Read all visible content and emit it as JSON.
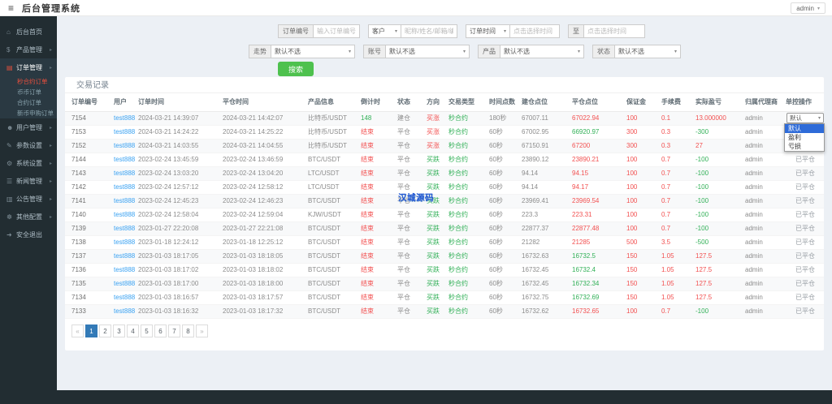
{
  "topbar": {
    "title": "后台管理系统",
    "user": "admin"
  },
  "sidebar": {
    "items": [
      {
        "key": "dashboard",
        "label": "后台首页",
        "icon": "home-icon",
        "glyph": "⌂",
        "arrow": false
      },
      {
        "key": "product",
        "label": "产品管理",
        "icon": "dollar-icon",
        "glyph": "$",
        "arrow": true
      },
      {
        "key": "order",
        "label": "订单管理",
        "icon": "order-icon",
        "glyph": "▤",
        "arrow": true,
        "active": true,
        "children": [
          {
            "key": "second-contract-orders",
            "label": "秒合约订单",
            "active": true
          },
          {
            "key": "coin-orders",
            "label": "币币订单"
          },
          {
            "key": "contract-orders",
            "label": "合约订单"
          },
          {
            "key": "new-coin-orders",
            "label": "新币申购订单"
          }
        ]
      },
      {
        "key": "user",
        "label": "用户管理",
        "icon": "user-icon",
        "glyph": "☻",
        "arrow": true
      },
      {
        "key": "params",
        "label": "参数设置",
        "icon": "document-icon",
        "glyph": "✎",
        "arrow": true
      },
      {
        "key": "system",
        "label": "系统设置",
        "icon": "gears-icon",
        "glyph": "⚙",
        "arrow": true
      },
      {
        "key": "news",
        "label": "新闻管理",
        "icon": "list-icon",
        "glyph": "☰",
        "arrow": true
      },
      {
        "key": "notice",
        "label": "公告管理",
        "icon": "bulletin-icon",
        "glyph": "▥",
        "arrow": true
      },
      {
        "key": "other",
        "label": "其他配置",
        "icon": "gear-icon",
        "glyph": "☸",
        "arrow": true
      },
      {
        "key": "logout",
        "label": "安全退出",
        "icon": "logout-icon",
        "glyph": "➜",
        "arrow": false
      }
    ]
  },
  "filters": {
    "row1": [
      {
        "label": "订单编号",
        "placeholder": "输入订单编号/订单id"
      },
      {
        "label": "客户",
        "placeholder": "昵称/姓名/邮箱/编号"
      },
      {
        "label": "订单时间",
        "placeholder": "点击选择时间"
      },
      {
        "label": "至",
        "placeholder": "点击选择时间"
      }
    ],
    "row2": [
      {
        "label": "走势",
        "value": "默认不选"
      },
      {
        "label": "账号",
        "value": "默认不选"
      },
      {
        "label": "产品",
        "value": "默认不选"
      },
      {
        "label": "状态",
        "value": "默认不选"
      }
    ],
    "search_label": "搜索"
  },
  "table": {
    "title": "交易记录",
    "headers": [
      "订单编号",
      "用户",
      "订单时间",
      "平仓时间",
      "产品信息",
      "倒计时",
      "状态",
      "方向",
      "交易类型",
      "时间点数",
      "建仓点位",
      "平仓点位",
      "保证金",
      "手续费",
      "实际盈亏",
      "归属代理商",
      "单控操作"
    ],
    "rows": [
      {
        "id": "7154",
        "user": "test888",
        "open_time": "2024-03-21 14:39:07",
        "close_time": "2024-03-21 14:42:07",
        "product": "比特币/USDT",
        "countdown": "148",
        "countdown_color": "green",
        "status": "建仓",
        "direction": "买涨",
        "direction_color": "red",
        "trade_type": "秒合约",
        "duration": "180秒",
        "open_price": "67007.11",
        "close_price": "67022.94",
        "close_price_color": "red",
        "margin": "100",
        "fee": "0.1",
        "profit": "13.000000",
        "profit_color": "red",
        "agent": "admin",
        "action": "select"
      },
      {
        "id": "7153",
        "user": "test888",
        "open_time": "2024-03-21 14:24:22",
        "close_time": "2024-03-21 14:25:22",
        "product": "比特币/USDT",
        "countdown": "结束",
        "countdown_color": "red",
        "status": "平仓",
        "direction": "买涨",
        "direction_color": "red",
        "trade_type": "秒合约",
        "duration": "60秒",
        "open_price": "67002.95",
        "close_price": "66920.97",
        "close_price_color": "green",
        "margin": "300",
        "fee": "0.3",
        "profit": "-300",
        "profit_color": "green",
        "agent": "admin",
        "action": ""
      },
      {
        "id": "7152",
        "user": "test888",
        "open_time": "2024-03-21 14:03:55",
        "close_time": "2024-03-21 14:04:55",
        "product": "比特币/USDT",
        "countdown": "结束",
        "countdown_color": "red",
        "status": "平仓",
        "direction": "买涨",
        "direction_color": "red",
        "trade_type": "秒合约",
        "duration": "60秒",
        "open_price": "67150.91",
        "close_price": "67200",
        "close_price_color": "red",
        "margin": "300",
        "fee": "0.3",
        "profit": "27",
        "profit_color": "red",
        "agent": "admin",
        "action": "已平仓"
      },
      {
        "id": "7144",
        "user": "test888",
        "open_time": "2023-02-24 13:45:59",
        "close_time": "2023-02-24 13:46:59",
        "product": "BTC/USDT",
        "countdown": "结束",
        "countdown_color": "red",
        "status": "平仓",
        "direction": "买跌",
        "direction_color": "green",
        "trade_type": "秒合约",
        "duration": "60秒",
        "open_price": "23890.12",
        "close_price": "23890.21",
        "close_price_color": "red",
        "margin": "100",
        "fee": "0.7",
        "profit": "-100",
        "profit_color": "green",
        "agent": "admin",
        "action": "已平仓"
      },
      {
        "id": "7143",
        "user": "test888",
        "open_time": "2023-02-24 13:03:20",
        "close_time": "2023-02-24 13:04:20",
        "product": "LTC/USDT",
        "countdown": "结束",
        "countdown_color": "red",
        "status": "平仓",
        "direction": "买跌",
        "direction_color": "green",
        "trade_type": "秒合约",
        "duration": "60秒",
        "open_price": "94.14",
        "close_price": "94.15",
        "close_price_color": "red",
        "margin": "100",
        "fee": "0.7",
        "profit": "-100",
        "profit_color": "green",
        "agent": "admin",
        "action": "已平仓"
      },
      {
        "id": "7142",
        "user": "test888",
        "open_time": "2023-02-24 12:57:12",
        "close_time": "2023-02-24 12:58:12",
        "product": "LTC/USDT",
        "countdown": "结束",
        "countdown_color": "red",
        "status": "平仓",
        "direction": "买跌",
        "direction_color": "green",
        "trade_type": "秒合约",
        "duration": "60秒",
        "open_price": "94.14",
        "close_price": "94.17",
        "close_price_color": "red",
        "margin": "100",
        "fee": "0.7",
        "profit": "-100",
        "profit_color": "green",
        "agent": "admin",
        "action": "已平仓"
      },
      {
        "id": "7141",
        "user": "test888",
        "open_time": "2023-02-24 12:45:23",
        "close_time": "2023-02-24 12:46:23",
        "product": "BTC/USDT",
        "countdown": "结束",
        "countdown_color": "red",
        "status": "平仓",
        "direction": "买跌",
        "direction_color": "green",
        "trade_type": "秒合约",
        "duration": "60秒",
        "open_price": "23969.41",
        "close_price": "23969.54",
        "close_price_color": "red",
        "margin": "100",
        "fee": "0.7",
        "profit": "-100",
        "profit_color": "green",
        "agent": "admin",
        "action": "已平仓"
      },
      {
        "id": "7140",
        "user": "test888",
        "open_time": "2023-02-24 12:58:04",
        "close_time": "2023-02-24 12:59:04",
        "product": "KJW/USDT",
        "countdown": "结束",
        "countdown_color": "red",
        "status": "平仓",
        "direction": "买跌",
        "direction_color": "green",
        "trade_type": "秒合约",
        "duration": "60秒",
        "open_price": "223.3",
        "close_price": "223.31",
        "close_price_color": "red",
        "margin": "100",
        "fee": "0.7",
        "profit": "-100",
        "profit_color": "green",
        "agent": "admin",
        "action": "已平仓"
      },
      {
        "id": "7139",
        "user": "test888",
        "open_time": "2023-01-27 22:20:08",
        "close_time": "2023-01-27 22:21:08",
        "product": "BTC/USDT",
        "countdown": "结束",
        "countdown_color": "red",
        "status": "平仓",
        "direction": "买跌",
        "direction_color": "green",
        "trade_type": "秒合约",
        "duration": "60秒",
        "open_price": "22877.37",
        "close_price": "22877.48",
        "close_price_color": "red",
        "margin": "100",
        "fee": "0.7",
        "profit": "-100",
        "profit_color": "green",
        "agent": "admin",
        "action": "已平仓"
      },
      {
        "id": "7138",
        "user": "test888",
        "open_time": "2023-01-18 12:24:12",
        "close_time": "2023-01-18 12:25:12",
        "product": "BTC/USDT",
        "countdown": "结束",
        "countdown_color": "red",
        "status": "平仓",
        "direction": "买跌",
        "direction_color": "green",
        "trade_type": "秒合约",
        "duration": "60秒",
        "open_price": "21282",
        "close_price": "21285",
        "close_price_color": "red",
        "margin": "500",
        "fee": "3.5",
        "profit": "-500",
        "profit_color": "green",
        "agent": "admin",
        "action": "已平仓"
      },
      {
        "id": "7137",
        "user": "test888",
        "open_time": "2023-01-03 18:17:05",
        "close_time": "2023-01-03 18:18:05",
        "product": "BTC/USDT",
        "countdown": "结束",
        "countdown_color": "red",
        "status": "平仓",
        "direction": "买跌",
        "direction_color": "green",
        "trade_type": "秒合约",
        "duration": "60秒",
        "open_price": "16732.63",
        "close_price": "16732.5",
        "close_price_color": "green",
        "margin": "150",
        "fee": "1.05",
        "profit": "127.5",
        "profit_color": "red",
        "agent": "admin",
        "action": "已平仓"
      },
      {
        "id": "7136",
        "user": "test888",
        "open_time": "2023-01-03 18:17:02",
        "close_time": "2023-01-03 18:18:02",
        "product": "BTC/USDT",
        "countdown": "结束",
        "countdown_color": "red",
        "status": "平仓",
        "direction": "买跌",
        "direction_color": "green",
        "trade_type": "秒合约",
        "duration": "60秒",
        "open_price": "16732.45",
        "close_price": "16732.4",
        "close_price_color": "green",
        "margin": "150",
        "fee": "1.05",
        "profit": "127.5",
        "profit_color": "red",
        "agent": "admin",
        "action": "已平仓"
      },
      {
        "id": "7135",
        "user": "test888",
        "open_time": "2023-01-03 18:17:00",
        "close_time": "2023-01-03 18:18:00",
        "product": "BTC/USDT",
        "countdown": "结束",
        "countdown_color": "red",
        "status": "平仓",
        "direction": "买跌",
        "direction_color": "green",
        "trade_type": "秒合约",
        "duration": "60秒",
        "open_price": "16732.45",
        "close_price": "16732.34",
        "close_price_color": "green",
        "margin": "150",
        "fee": "1.05",
        "profit": "127.5",
        "profit_color": "red",
        "agent": "admin",
        "action": "已平仓"
      },
      {
        "id": "7134",
        "user": "test888",
        "open_time": "2023-01-03 18:16:57",
        "close_time": "2023-01-03 18:17:57",
        "product": "BTC/USDT",
        "countdown": "结束",
        "countdown_color": "red",
        "status": "平仓",
        "direction": "买跌",
        "direction_color": "green",
        "trade_type": "秒合约",
        "duration": "60秒",
        "open_price": "16732.75",
        "close_price": "16732.69",
        "close_price_color": "green",
        "margin": "150",
        "fee": "1.05",
        "profit": "127.5",
        "profit_color": "red",
        "agent": "admin",
        "action": "已平仓"
      },
      {
        "id": "7133",
        "user": "test888",
        "open_time": "2023-01-03 18:16:32",
        "close_time": "2023-01-03 18:17:32",
        "product": "BTC/USDT",
        "countdown": "结束",
        "countdown_color": "red",
        "status": "平仓",
        "direction": "买跌",
        "direction_color": "green",
        "trade_type": "秒合约",
        "duration": "60秒",
        "open_price": "16732.62",
        "close_price": "16732.65",
        "close_price_color": "red",
        "margin": "100",
        "fee": "0.7",
        "profit": "-100",
        "profit_color": "green",
        "agent": "admin",
        "action": "已平仓"
      }
    ]
  },
  "action_select": {
    "value": "默认"
  },
  "action_menu": {
    "options": [
      "默认",
      "盈利",
      "亏损"
    ],
    "selected": "默认"
  },
  "pagination": {
    "prev": "«",
    "pages": [
      "1",
      "2",
      "3",
      "4",
      "5",
      "6",
      "7",
      "8"
    ],
    "next": "»",
    "active": "1"
  },
  "watermark": "汉城源码",
  "colors": {
    "accent_red": "#f25050",
    "accent_green": "#31b057",
    "link_blue": "#3aa2f2",
    "search_green": "#4ec14e",
    "pagination_active": "#337ab7",
    "sidebar_bg": "#222d32",
    "menu_selected_bg": "#2e6bd8"
  }
}
